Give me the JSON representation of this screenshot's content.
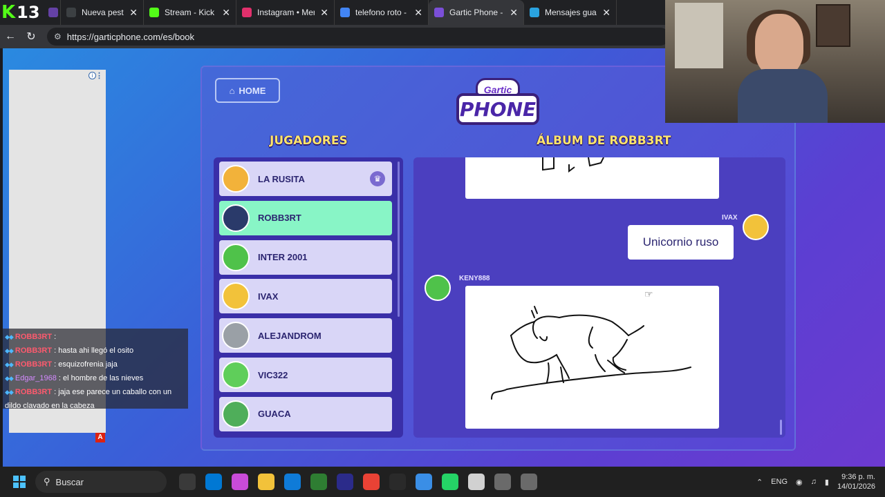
{
  "stream_badge": {
    "count": "13"
  },
  "tabs": [
    {
      "label": "Nueva pestaña",
      "color": "#3c4043",
      "active": false
    },
    {
      "label": "Stream - Kick Dash",
      "color": "#53fc18",
      "active": false
    },
    {
      "label": "Instagram • Mensa",
      "color": "#e1306c",
      "active": false
    },
    {
      "label": "telefono roto - Bús",
      "color": "#4285f4",
      "active": false
    },
    {
      "label": "Gartic Phone - Tele",
      "color": "#7b4fd8",
      "active": true
    },
    {
      "label": "Mensajes guardad",
      "color": "#2aa3e0",
      "active": false
    }
  ],
  "address": {
    "url": "https://garticphone.com/es/book"
  },
  "page": {
    "home_label": "HOME",
    "logo_top": "Gartic",
    "logo_main": "PHONE",
    "players_heading": "JUGADORES",
    "album_heading": "ÁLBUM DE ROBB3RT",
    "players": [
      {
        "name": "LA RUSITA",
        "color": "#f2b23a",
        "host": true,
        "me": false
      },
      {
        "name": "ROBB3RT",
        "color": "#2a3a6a",
        "host": false,
        "me": true
      },
      {
        "name": "INTER 2001",
        "color": "#4fc24a",
        "host": false,
        "me": false
      },
      {
        "name": "IVAX",
        "color": "#f2c23a",
        "host": false,
        "me": false
      },
      {
        "name": "ALEJANDROM",
        "color": "#9aa0a6",
        "host": false,
        "me": false
      },
      {
        "name": "VIC322",
        "color": "#5fce5a",
        "host": false,
        "me": false
      },
      {
        "name": "GUACA",
        "color": "#4fae5a",
        "host": false,
        "me": false
      }
    ],
    "album": {
      "ivax_author": "IVAX",
      "ivax_text": "Unicornio ruso",
      "keny_author": "KENY888"
    }
  },
  "chat": [
    {
      "user": "ROBB3RT",
      "text": "",
      "style": "r"
    },
    {
      "user": "ROBB3RT",
      "text": "hasta ahi llegó el osito",
      "style": "r"
    },
    {
      "user": "ROBB3RT",
      "text": "esquizofrenia jaja",
      "style": "r"
    },
    {
      "user": "Edgar_1968",
      "text": "el hombre de las nieves",
      "style": "p"
    },
    {
      "user": "ROBB3RT",
      "text": "jaja ese parece un caballo con un dildo clavado en la cabeza",
      "style": "r"
    }
  ],
  "taskbar": {
    "search_label": "Buscar",
    "lang": "ENG",
    "time": "9:36 p. m.",
    "date": "14/01/2026",
    "icons": [
      "#3a3a3a",
      "#0078d4",
      "#c94bd8",
      "#f2c23a",
      "#0f7bd8",
      "#2e7d32",
      "#2b2b8a",
      "#e94235",
      "#2a2a2a",
      "#3a8ee6",
      "#25d366",
      "#d1d1d1",
      "#6a6a6a",
      "#6a6a6a"
    ]
  }
}
